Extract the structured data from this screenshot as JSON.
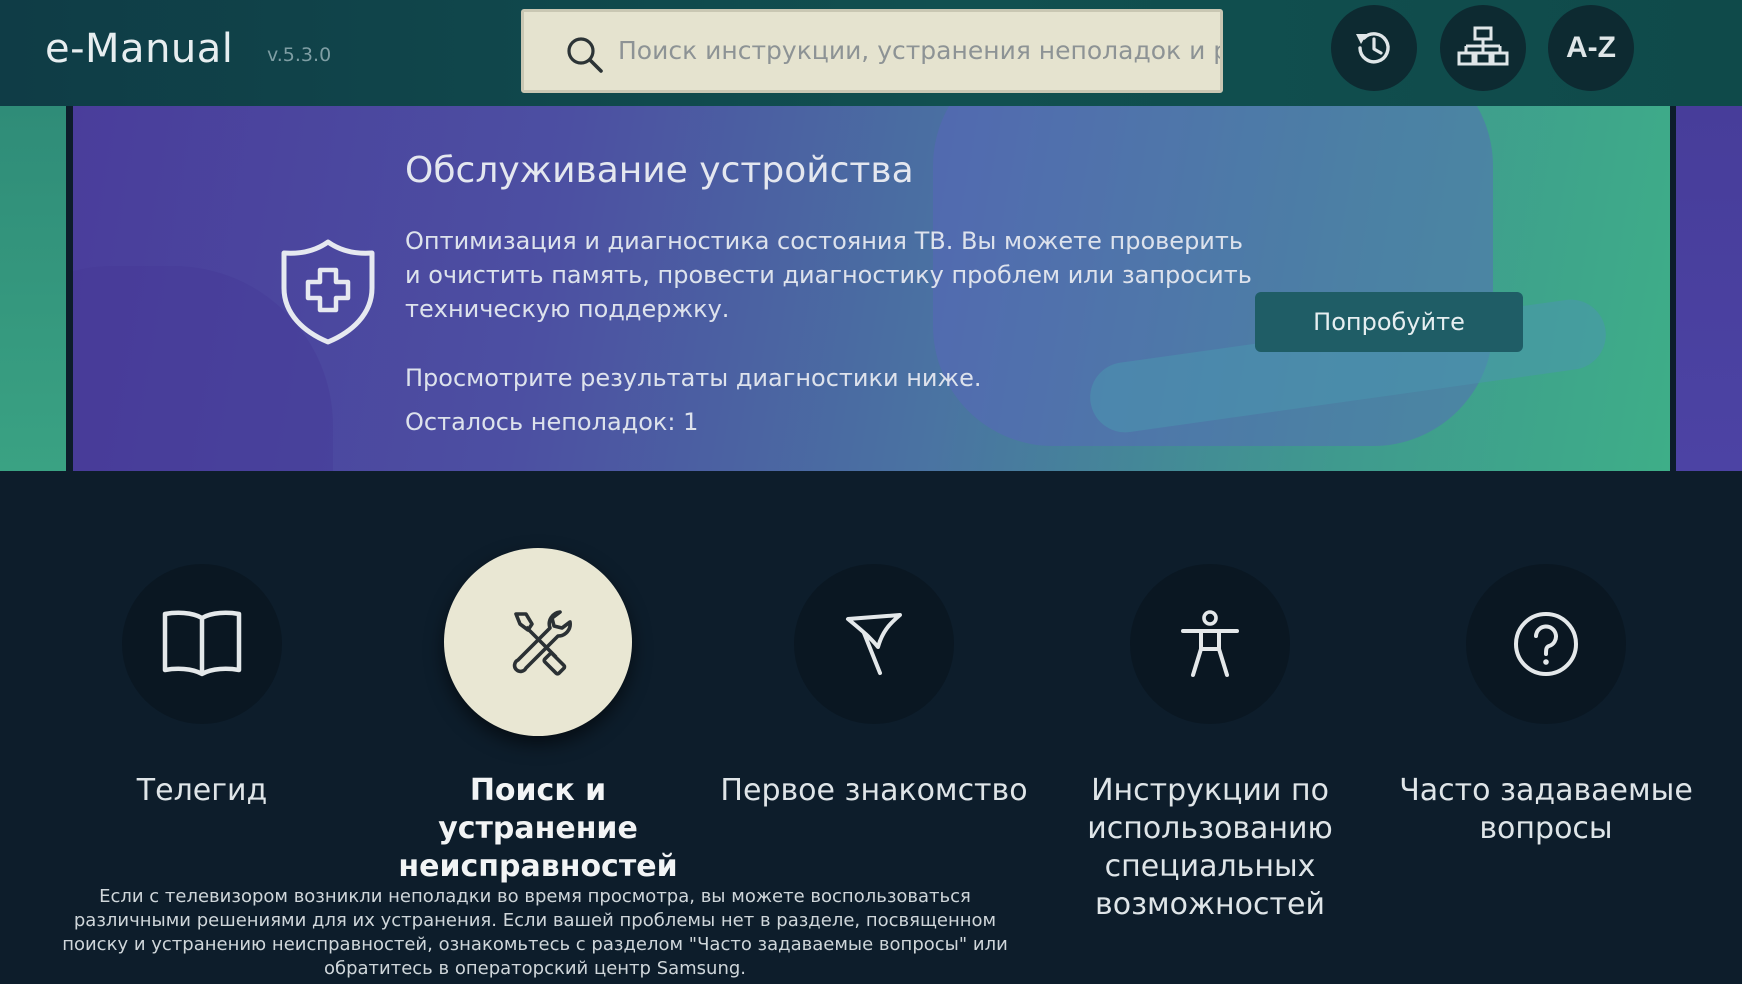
{
  "header": {
    "title": "e-Manual",
    "version": "v.5.3.0",
    "search": {
      "placeholder": "Поиск инструкции, устранения неполадок и р",
      "value": ""
    },
    "buttons": {
      "history_icon": "history-icon",
      "tree_icon": "sitemap-icon",
      "az_label": "A-Z"
    }
  },
  "banner": {
    "icon": "shield-plus-icon",
    "title": "Обслуживание устройства",
    "description": "Оптимизация и диагностика состояния ТВ. Вы можете проверить и очистить память, провести диагностику проблем или запросить техническую поддержку.",
    "hint": "Просмотрите результаты диагностики ниже.",
    "remaining": "Осталось неполадок: 1",
    "button_label": "Попробуйте"
  },
  "categories": [
    {
      "label": "Телегид",
      "icon": "book-icon",
      "selected": false
    },
    {
      "label": "Поиск и устранение неисправностей",
      "icon": "tools-icon",
      "selected": true
    },
    {
      "label": "Первое знакомство",
      "icon": "flag-icon",
      "selected": false
    },
    {
      "label": "Инструкции по использованию специальных возможностей",
      "icon": "accessibility-icon",
      "selected": false
    },
    {
      "label": "Часто задаваемые вопросы",
      "icon": "question-icon",
      "selected": false
    }
  ],
  "selected_description": "Если с телевизором возникли неполадки во время просмотра, вы можете воспользоваться различными решениями для их устранения. Если вашей проблемы нет в разделе, посвященном поиску и устранению неисправностей, ознакомьтесь с разделом \"Часто задаваемые вопросы\" или обратитесь в операторский центр Samsung."
}
